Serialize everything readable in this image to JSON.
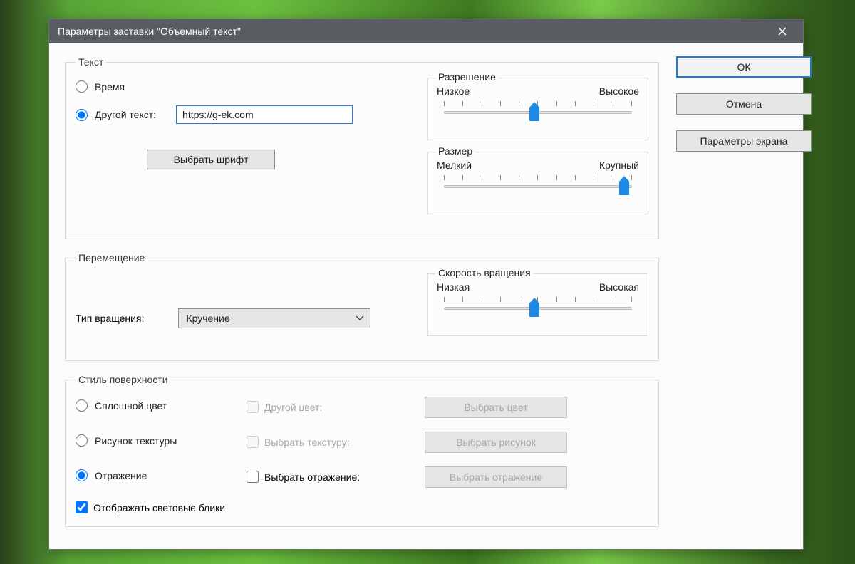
{
  "window": {
    "title": "Параметры заставки \"Объемный текст\""
  },
  "buttons": {
    "ok": "ОК",
    "cancel": "Отмена",
    "display_params": "Параметры экрана",
    "choose_font": "Выбрать шрифт",
    "choose_color": "Выбрать цвет",
    "choose_picture": "Выбрать рисунок",
    "choose_reflection": "Выбрать отражение"
  },
  "text_group": {
    "legend": "Текст",
    "time_label": "Время",
    "custom_text_label": "Другой текст:",
    "custom_text_value": "https://g-ek.com",
    "selected": "custom"
  },
  "resolution": {
    "legend": "Разрешение",
    "low": "Низкое",
    "high": "Высокое",
    "value_percent": 48
  },
  "size": {
    "legend": "Размер",
    "low": "Мелкий",
    "high": "Крупный",
    "value_percent": 96
  },
  "move_group": {
    "legend": "Перемещение",
    "rotation_type_label": "Тип вращения:",
    "rotation_value": "Кручение"
  },
  "speed": {
    "legend": "Скорость вращения",
    "low": "Низкая",
    "high": "Высокая",
    "value_percent": 48
  },
  "surface_group": {
    "legend": "Стиль поверхности",
    "solid_color": "Сплошной цвет",
    "texture_picture": "Рисунок текстуры",
    "reflection": "Отражение",
    "selected": "reflection",
    "custom_color": "Другой цвет:",
    "choose_texture": "Выбрать текстуру:",
    "choose_reflection_chk": "Выбрать отражение:",
    "show_highlights": "Отображать световые блики"
  }
}
